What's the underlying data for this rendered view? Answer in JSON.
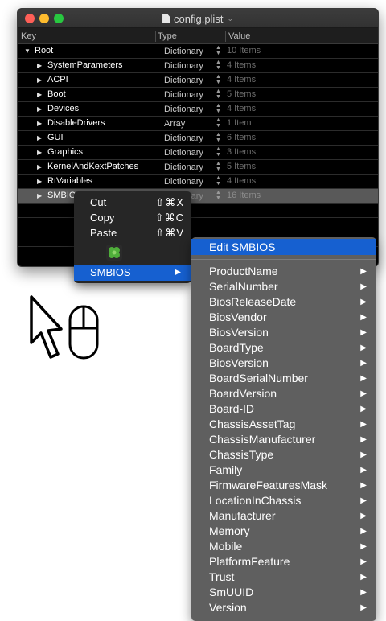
{
  "window": {
    "title": "config.plist",
    "columns": {
      "key": "Key",
      "type": "Type",
      "value": "Value"
    }
  },
  "rows": [
    {
      "key": "Root",
      "type": "Dictionary",
      "value": "10 Items",
      "level": 0,
      "expanded": true
    },
    {
      "key": "SystemParameters",
      "type": "Dictionary",
      "value": "4 Items",
      "level": 1
    },
    {
      "key": "ACPI",
      "type": "Dictionary",
      "value": "4 Items",
      "level": 1
    },
    {
      "key": "Boot",
      "type": "Dictionary",
      "value": "5 Items",
      "level": 1
    },
    {
      "key": "Devices",
      "type": "Dictionary",
      "value": "4 Items",
      "level": 1
    },
    {
      "key": "DisableDrivers",
      "type": "Array",
      "value": "1 Item",
      "level": 1
    },
    {
      "key": "GUI",
      "type": "Dictionary",
      "value": "6 Items",
      "level": 1
    },
    {
      "key": "Graphics",
      "type": "Dictionary",
      "value": "3 Items",
      "level": 1
    },
    {
      "key": "KernelAndKextPatches",
      "type": "Dictionary",
      "value": "5 Items",
      "level": 1
    },
    {
      "key": "RtVariables",
      "type": "Dictionary",
      "value": "4 Items",
      "level": 1
    },
    {
      "key": "SMBIOS",
      "type": "Dictionary",
      "value": "16 Items",
      "level": 1,
      "selected": true
    }
  ],
  "context_menu": {
    "items": [
      {
        "label": "Cut",
        "shortcut": "⇧⌘X"
      },
      {
        "label": "Copy",
        "shortcut": "⇧⌘C"
      },
      {
        "label": "Paste",
        "shortcut": "⇧⌘V"
      }
    ],
    "icon": "clover-icon",
    "submenu_label": "SMBIOS"
  },
  "submenu": {
    "edit_label": "Edit SMBIOS",
    "items": [
      "ProductName",
      "SerialNumber",
      "BiosReleaseDate",
      "BiosVendor",
      "BiosVersion",
      "BoardType",
      "BiosVersion",
      "BoardSerialNumber",
      "BoardVersion",
      "Board-ID",
      "ChassisAssetTag",
      "ChassisManufacturer",
      "ChassisType",
      "Family",
      "FirmwareFeaturesMask",
      "LocationInChassis",
      "Manufacturer",
      "Memory",
      "Mobile",
      "PlatformFeature",
      "Trust",
      "SmUUID",
      "Version"
    ]
  },
  "colors": {
    "selection": "#1660d0",
    "close": "#fe5f57",
    "minimize": "#febc2e",
    "maximize": "#28c840"
  },
  "icons": {
    "pointer": "arrow-cursor-icon",
    "mouse": "mouse-right-click-icon"
  }
}
